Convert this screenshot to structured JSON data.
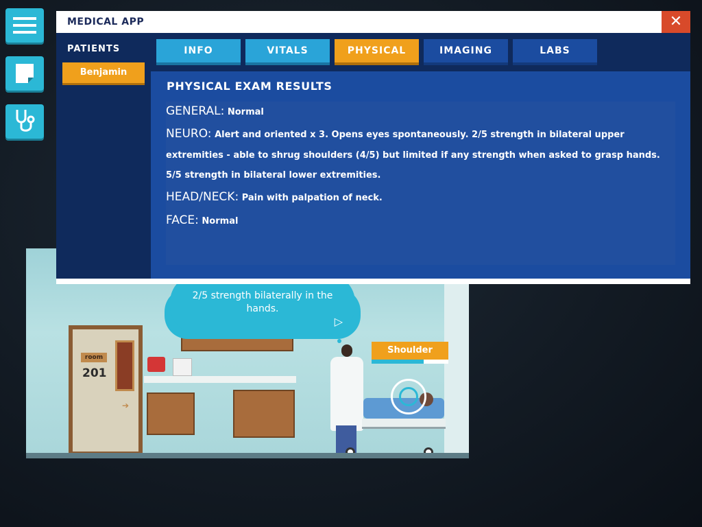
{
  "left_toolbar": {
    "menu_icon": "hamburger-menu-icon",
    "notes_icon": "notepad-icon",
    "stethoscope_icon": "stethoscope-icon"
  },
  "modal": {
    "title": "MEDICAL APP",
    "close_icon": "close-icon",
    "sidebar": {
      "title": "PATIENTS",
      "patients": [
        "Benjamin"
      ]
    },
    "tabs": [
      "INFO",
      "VITALS",
      "PHYSICAL",
      "IMAGING",
      "LABS"
    ],
    "active_tab": "PHYSICAL",
    "content": {
      "heading": "PHYSICAL EXAM RESULTS",
      "sections": [
        {
          "label": "GENERAL:",
          "text": "Normal"
        },
        {
          "label": "NEURO:",
          "text": "Alert and oriented x 3. Opens eyes spontaneously. 2/5 strength in bilateral upper extremities - able to shrug shoulders (4/5) but limited if any strength when asked to grasp hands. 5/5 strength in bilateral lower extremities."
        },
        {
          "label": "HEAD/NECK:",
          "text": "Pain with palpation of neck."
        },
        {
          "label": "FACE:",
          "text": "Normal"
        }
      ]
    }
  },
  "scene": {
    "door_plate": "room",
    "room_number": "201",
    "speech": {
      "text": "2/5 strength bilaterally in the hands.",
      "next_icon": "play-arrow-icon"
    },
    "target": {
      "label": "Shoulder",
      "progress": 0.68
    }
  },
  "colors": {
    "accent_orange": "#f0a01c",
    "accent_cyan": "#2bb8d6",
    "panel_navy": "#0f2a5c",
    "content_blue": "#1b4ca0",
    "close_red": "#d84a2a"
  }
}
